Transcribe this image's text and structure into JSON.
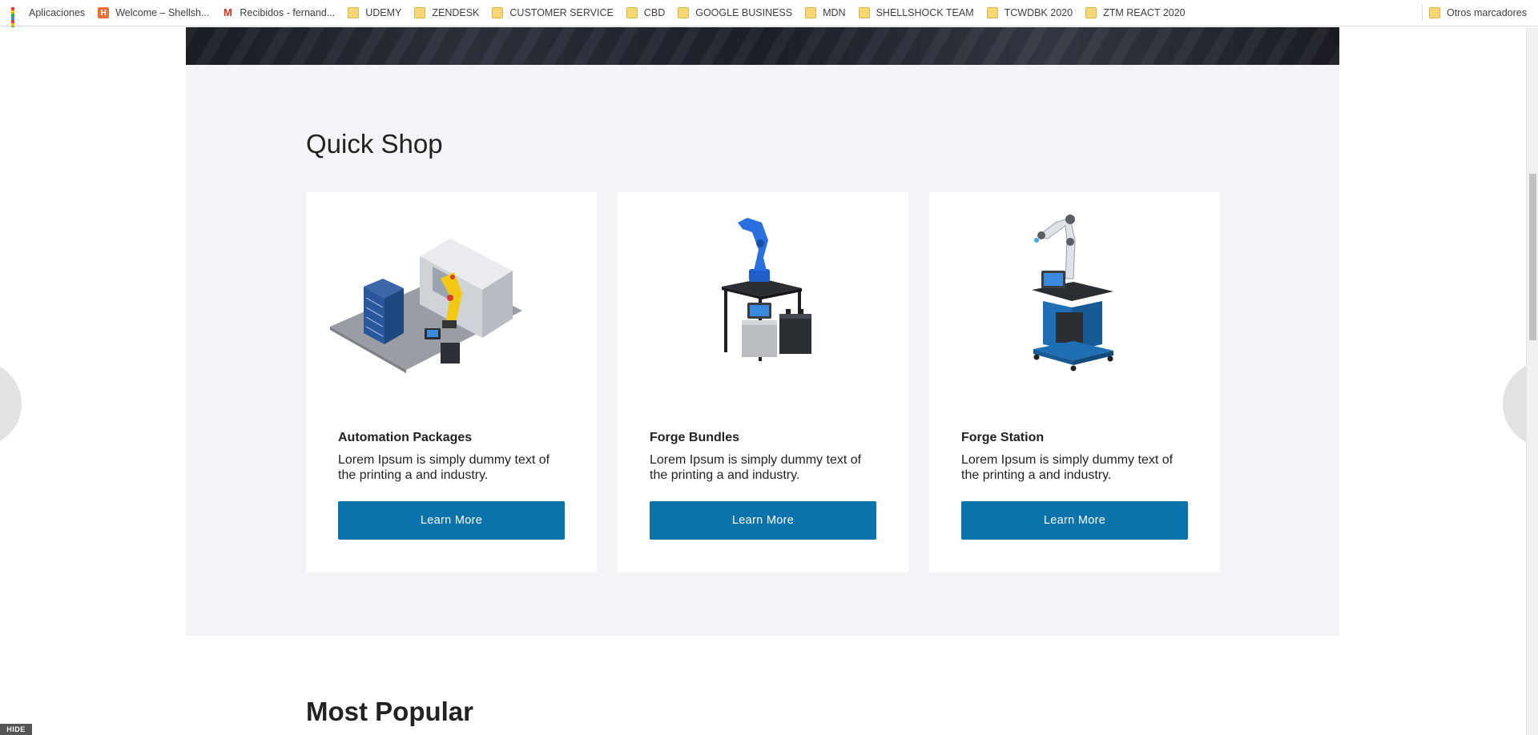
{
  "bookmarks": [
    {
      "label": "Aplicaciones",
      "icon": "apps-grid-icon"
    },
    {
      "label": "Welcome – Shellsh...",
      "icon": "h-site-icon"
    },
    {
      "label": "Recibidos - fernand...",
      "icon": "gmail-icon"
    },
    {
      "label": "UDEMY",
      "icon": "folder-icon"
    },
    {
      "label": "ZENDESK",
      "icon": "folder-icon"
    },
    {
      "label": "CUSTOMER SERVICE",
      "icon": "folder-icon"
    },
    {
      "label": "CBD",
      "icon": "folder-icon"
    },
    {
      "label": "GOOGLE BUSINESS",
      "icon": "folder-icon"
    },
    {
      "label": "MDN",
      "icon": "folder-icon"
    },
    {
      "label": "SHELLSHOCK TEAM",
      "icon": "folder-icon"
    },
    {
      "label": "TCWDBK 2020",
      "icon": "folder-icon"
    },
    {
      "label": "ZTM REACT 2020",
      "icon": "folder-icon"
    }
  ],
  "other_bookmarks": "Otros marcadores",
  "quick_shop": {
    "title": "Quick Shop",
    "cards": [
      {
        "title": "Automation Packages",
        "description": "Lorem Ipsum is simply dummy text of the printing a and industry.",
        "button": "Learn More",
        "image": "automation-package-image"
      },
      {
        "title": "Forge Bundles",
        "description": "Lorem Ipsum is simply dummy text of the printing a and industry.",
        "button": "Learn More",
        "image": "forge-bundle-image"
      },
      {
        "title": "Forge Station",
        "description": "Lorem Ipsum is simply dummy text of the printing a and industry.",
        "button": "Learn More",
        "image": "forge-station-image"
      }
    ]
  },
  "most_popular": {
    "title": "Most Popular"
  },
  "hide_label": "HIDE",
  "colors": {
    "button": "#0a73ab",
    "section_bg": "#f4f4f8",
    "card_bg": "#ffffff",
    "robot_blue": "#1f5fc9",
    "robot_yellow": "#f2c811"
  }
}
